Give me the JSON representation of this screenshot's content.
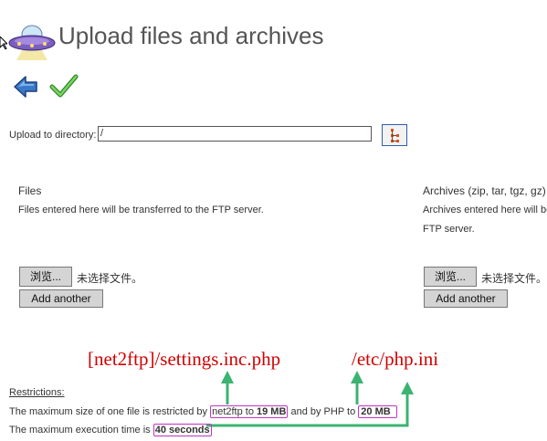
{
  "page": {
    "title": "Upload files and archives"
  },
  "toolbar": {
    "back_icon": "back-arrow-icon",
    "submit_icon": "checkmark-icon"
  },
  "directory": {
    "label": "Upload to directory:",
    "value": "/"
  },
  "files": {
    "heading": "Files",
    "description": "Files entered here will be transferred to the FTP server.",
    "browse_label": "浏览...",
    "no_file": "未选择文件。",
    "add_label": "Add another"
  },
  "archives": {
    "heading": "Archives (zip, tar, tgz, gz)",
    "description_line1": "Archives entered here will be",
    "description_line2": "FTP server.",
    "browse_label": "浏览...",
    "no_file": "未选择文件。",
    "add_label": "Add another"
  },
  "annotations": {
    "settings_file": "[net2ftp]/settings.inc.php",
    "php_ini": "/etc/php.ini",
    "arrow_color": "#3cb371"
  },
  "restrictions": {
    "heading": "Restrictions:",
    "line1_prefix": "The maximum size of one file is restricted by ",
    "line1_net2ftp": "net2ftp",
    "line1_to": " to ",
    "line1_size1": "19 MB",
    "line1_middle": " and by PHP to ",
    "line1_size2": "20 MB",
    "line2_prefix": "The maximum execution time is ",
    "line2_value": "40 seconds"
  }
}
